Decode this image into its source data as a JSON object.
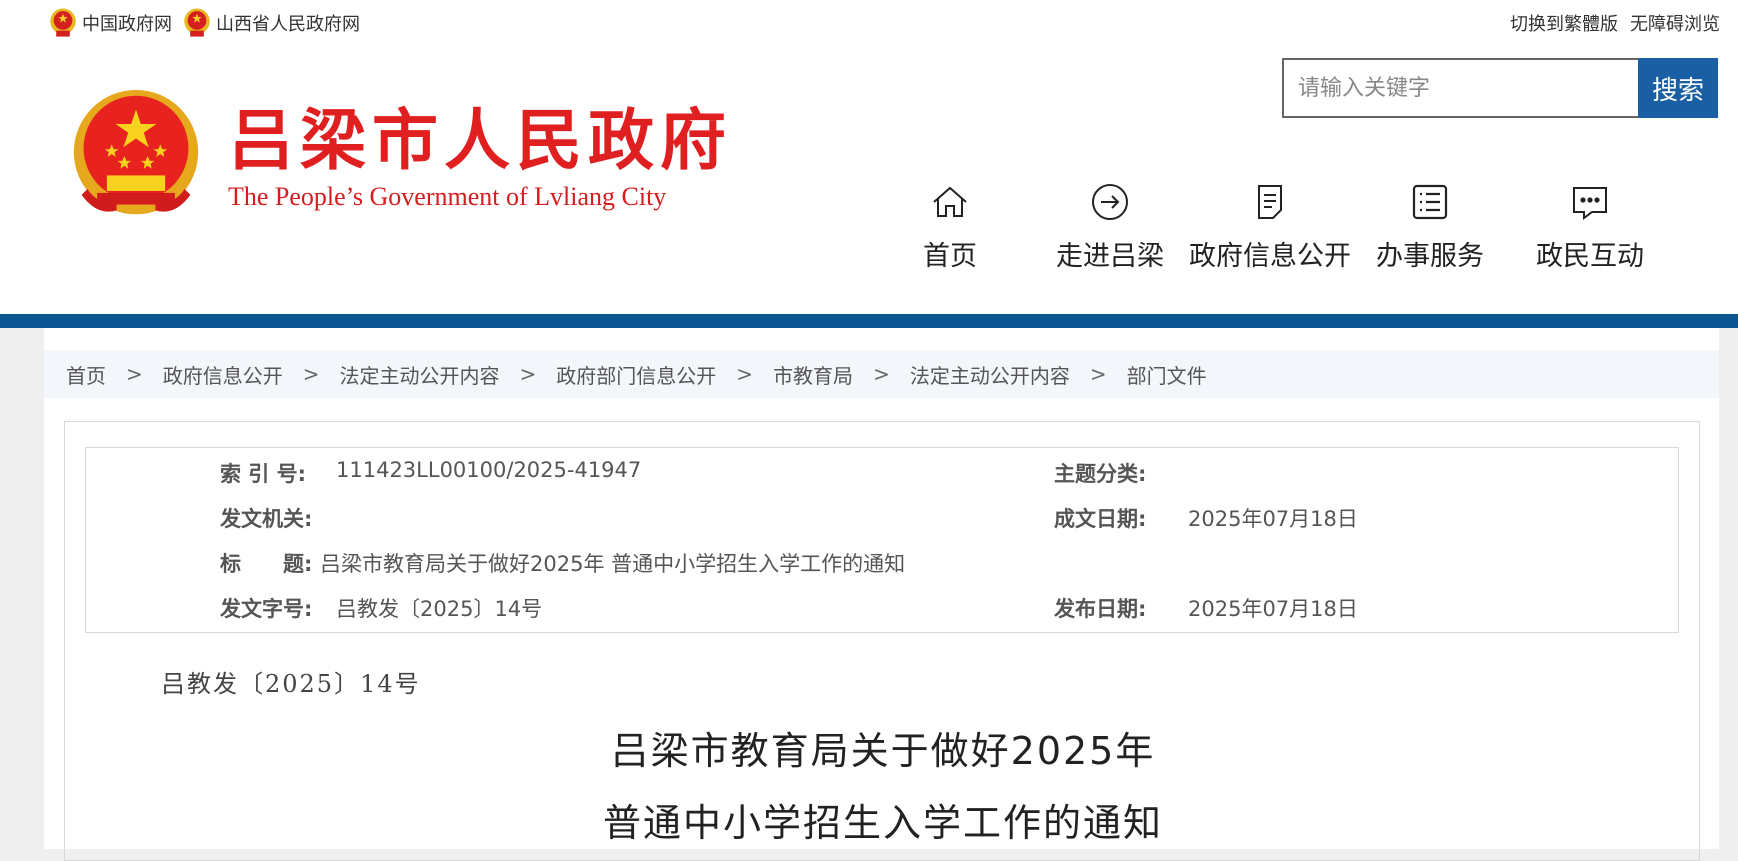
{
  "topbar": {
    "links": [
      "中国政府网",
      "山西省人民政府网"
    ],
    "right": [
      "切换到繁體版",
      "无障碍浏览"
    ]
  },
  "search": {
    "placeholder": "请输入关键字",
    "button": "搜索"
  },
  "logo": {
    "cn": "吕梁市人民政府",
    "en": "The People’s Government of Lvliang City"
  },
  "nav": [
    {
      "label": "首页",
      "icon": "home-icon"
    },
    {
      "label": "走进吕梁",
      "icon": "arrow-circle-icon"
    },
    {
      "label": "政府信息公开",
      "icon": "document-icon"
    },
    {
      "label": "办事服务",
      "icon": "list-icon"
    },
    {
      "label": "政民互动",
      "icon": "chat-icon"
    }
  ],
  "breadcrumb": [
    "首页",
    "政府信息公开",
    "法定主动公开内容",
    "政府部门信息公开",
    "市教育局",
    "法定主动公开内容",
    "部门文件"
  ],
  "meta": {
    "index_label": "索 引 号:",
    "index_value": "111423LL00100/2025-41947",
    "topic_label": "主题分类:",
    "topic_value": "",
    "issuer_label": "发文机关:",
    "issuer_value": "",
    "created_label": "成文日期:",
    "created_value": "2025年07月18日",
    "title_label": "标　　题:",
    "title_value": "吕梁市教育局关于做好2025年 普通中小学招生入学工作的通知",
    "docno_label": "发文字号:",
    "docno_value": "吕教发〔2025〕14号",
    "published_label": "发布日期:",
    "published_value": "2025年07月18日"
  },
  "document": {
    "number": "吕教发〔2025〕14号",
    "title_line1": "吕梁市教育局关于做好2025年",
    "title_line2": "普通中小学招生入学工作的通知"
  },
  "colors": {
    "brand_blue": "#0b5592",
    "search_blue": "#1a5fa3",
    "logo_red": "#e02020"
  }
}
